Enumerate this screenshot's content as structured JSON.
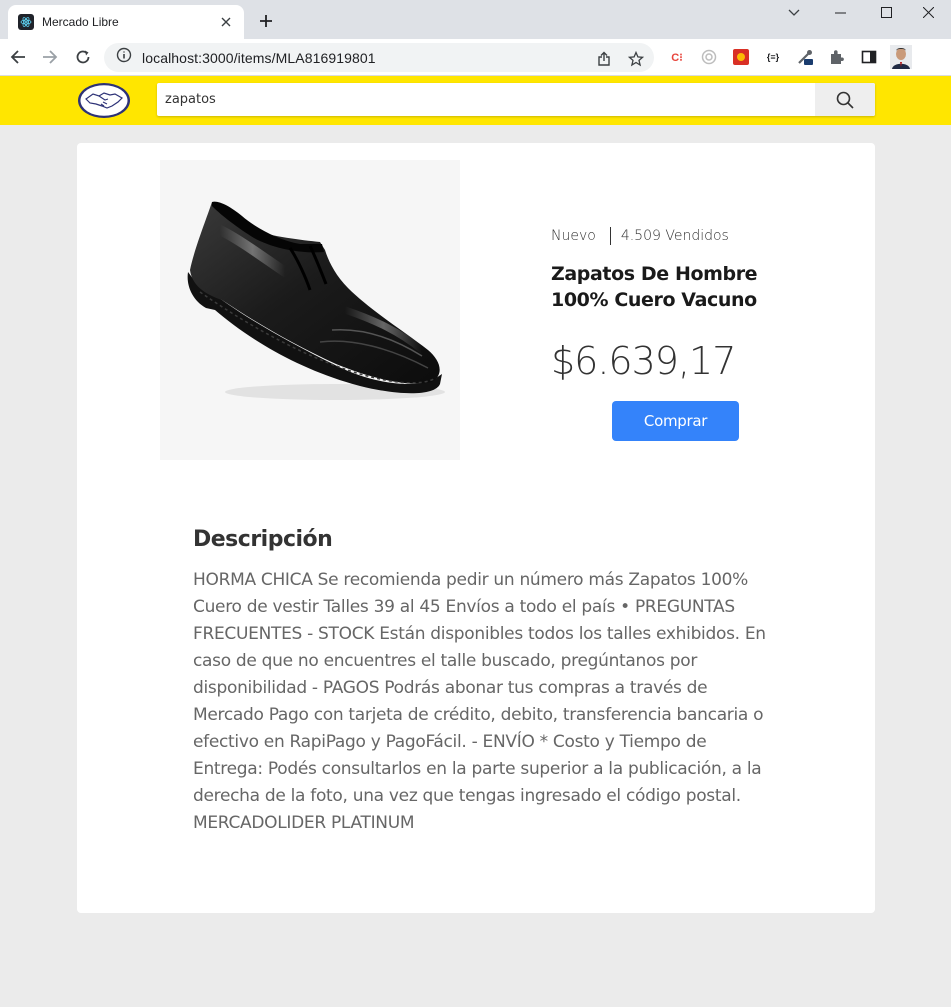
{
  "browser": {
    "tab_title": "Mercado Libre",
    "url": "localhost:3000/items/MLA816919801"
  },
  "header": {
    "search_value": "zapatos"
  },
  "product": {
    "condition": "Nuevo",
    "sold": "4.509 Vendidos",
    "title": "Zapatos De Hombre 100% Cuero Vacuno",
    "price": "$6.639,17",
    "buy_label": "Comprar"
  },
  "description": {
    "title": "Descripción",
    "text": "HORMA CHICA Se recomienda pedir un número más Zapatos 100% Cuero de vestir Talles 39 al 45 Envíos a todo el país • PREGUNTAS FRECUENTES - STOCK Están disponibles todos los talles exhibidos. En caso de que no encuentres el talle buscado, pregúntanos por disponibilidad - PAGOS Podrás abonar tus compras a través de Mercado Pago con tarjeta de crédito, debito, transferencia bancaria o efectivo en RapiPago y PagoFácil. - ENVÍO * Costo y Tiempo de Entrega: Podés consultarlos en la parte superior a la publicación, a la derecha de la foto, una vez que tengas ingresado el código postal. MERCADOLIDER PLATINUM"
  },
  "colors": {
    "brand_yellow": "#ffe600",
    "buy_blue": "#3483fa",
    "page_bg": "#ebebeb"
  }
}
